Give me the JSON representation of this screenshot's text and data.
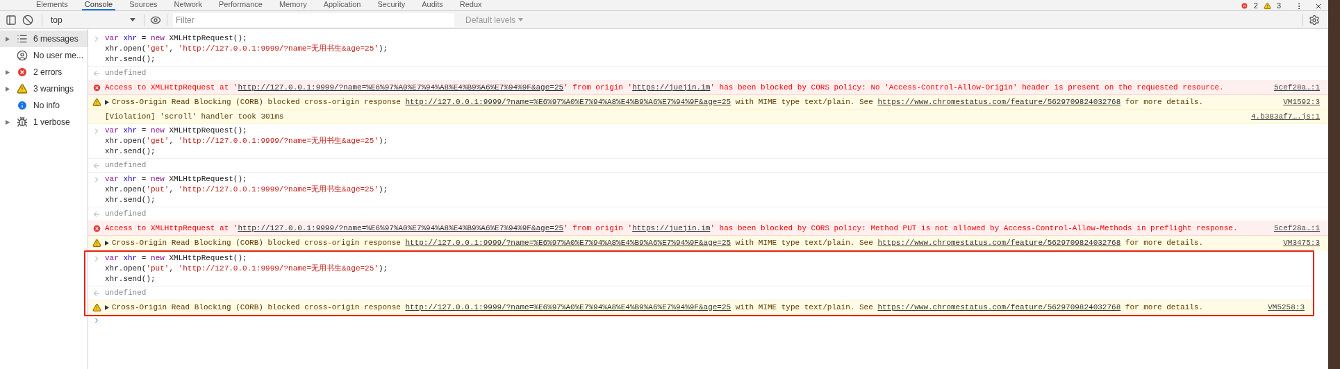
{
  "tabs": [
    {
      "label": "Elements",
      "selected": false
    },
    {
      "label": "Console",
      "selected": true
    },
    {
      "label": "Sources",
      "selected": false
    },
    {
      "label": "Network",
      "selected": false
    },
    {
      "label": "Performance",
      "selected": false
    },
    {
      "label": "Memory",
      "selected": false
    },
    {
      "label": "Application",
      "selected": false
    },
    {
      "label": "Security",
      "selected": false
    },
    {
      "label": "Audits",
      "selected": false
    },
    {
      "label": "Redux",
      "selected": false
    }
  ],
  "counts": {
    "errors": "2",
    "warnings": "3"
  },
  "toolbar": {
    "context": "top",
    "filter_placeholder": "Filter",
    "levels": "Default levels"
  },
  "sidebar": [
    {
      "kind": "list",
      "label": "6 messages",
      "selected": true,
      "expandable": true
    },
    {
      "kind": "user",
      "label": "No user me...",
      "selected": false,
      "expandable": false
    },
    {
      "kind": "error",
      "label": "2 errors",
      "selected": false,
      "expandable": true
    },
    {
      "kind": "warning",
      "label": "3 warnings",
      "selected": false,
      "expandable": true
    },
    {
      "kind": "info",
      "label": "No info",
      "selected": false,
      "expandable": false
    },
    {
      "kind": "verbose",
      "label": "1 verbose",
      "selected": false,
      "expandable": true
    }
  ],
  "entries": [
    {
      "kind": "input",
      "highlighted": false,
      "lines": [
        [
          {
            "kind": "keyword",
            "t": "var"
          },
          {
            "kind": "variable",
            "t": " xhr"
          },
          {
            "kind": "plain",
            "t": " = "
          },
          {
            "kind": "keyword",
            "t": "new"
          },
          {
            "kind": "plain",
            "t": " XMLHttpRequest();"
          }
        ],
        [
          {
            "kind": "plain",
            "t": "xhr.open("
          },
          {
            "kind": "string",
            "t": "'get'"
          },
          {
            "kind": "plain",
            "t": ", "
          },
          {
            "kind": "string",
            "t": "'http://127.0.0.1:9999/?name=无用书生&age=25'"
          },
          {
            "kind": "plain",
            "t": ");"
          }
        ],
        [
          {
            "kind": "plain",
            "t": "xhr.send();"
          }
        ]
      ]
    },
    {
      "kind": "result",
      "highlighted": false,
      "text": "undefined"
    },
    {
      "kind": "error",
      "highlighted": false,
      "expandable": false,
      "segments": [
        {
          "kind": "text",
          "t": "Access to XMLHttpRequest at '"
        },
        {
          "kind": "link",
          "t": "http://127.0.0.1:9999/?name=%E6%97%A0%E7%94%A8%E4%B9%A6%E7%94%9F&age=25"
        },
        {
          "kind": "text",
          "t": "' from origin '"
        },
        {
          "kind": "link",
          "t": "https://juejin.im"
        },
        {
          "kind": "text",
          "t": "' has been blocked by CORS policy: No 'Access-Control-Allow-Origin' header is present on the requested resource."
        }
      ],
      "source": "5cef28a…:1"
    },
    {
      "kind": "warning",
      "highlighted": false,
      "expandable": true,
      "segments": [
        {
          "kind": "text",
          "t": "Cross-Origin Read Blocking (CORB) blocked cross-origin response "
        },
        {
          "kind": "link",
          "t": "http://127.0.0.1:9999/?name=%E6%97%A0%E7%94%A8%E4%B9%A6%E7%94%9F&age=25"
        },
        {
          "kind": "text",
          "t": " with MIME type text/plain. See "
        },
        {
          "kind": "link",
          "t": "https://www.chromestatus.com/feature/5629709824032768"
        },
        {
          "kind": "text",
          "t": " for more details."
        }
      ],
      "source": "VM1592:3"
    },
    {
      "kind": "violation",
      "highlighted": false,
      "expandable": false,
      "segments": [
        {
          "kind": "text",
          "t": "[Violation] 'scroll' handler took 301ms"
        }
      ],
      "source": "4.b383af7….js:1"
    },
    {
      "kind": "input",
      "highlighted": false,
      "lines": [
        [
          {
            "kind": "keyword",
            "t": "var"
          },
          {
            "kind": "variable",
            "t": " xhr"
          },
          {
            "kind": "plain",
            "t": " = "
          },
          {
            "kind": "keyword",
            "t": "new"
          },
          {
            "kind": "plain",
            "t": " XMLHttpRequest();"
          }
        ],
        [
          {
            "kind": "plain",
            "t": "xhr.open("
          },
          {
            "kind": "string",
            "t": "'get'"
          },
          {
            "kind": "plain",
            "t": ", "
          },
          {
            "kind": "string",
            "t": "'http://127.0.0.1:9999/?name=无用书生&age=25'"
          },
          {
            "kind": "plain",
            "t": ");"
          }
        ],
        [
          {
            "kind": "plain",
            "t": "xhr.send();"
          }
        ]
      ]
    },
    {
      "kind": "result",
      "highlighted": false,
      "text": "undefined"
    },
    {
      "kind": "input",
      "highlighted": false,
      "lines": [
        [
          {
            "kind": "keyword",
            "t": "var"
          },
          {
            "kind": "variable",
            "t": " xhr"
          },
          {
            "kind": "plain",
            "t": " = "
          },
          {
            "kind": "keyword",
            "t": "new"
          },
          {
            "kind": "plain",
            "t": " XMLHttpRequest();"
          }
        ],
        [
          {
            "kind": "plain",
            "t": "xhr.open("
          },
          {
            "kind": "string",
            "t": "'put'"
          },
          {
            "kind": "plain",
            "t": ", "
          },
          {
            "kind": "string",
            "t": "'http://127.0.0.1:9999/?name=无用书生&age=25'"
          },
          {
            "kind": "plain",
            "t": ");"
          }
        ],
        [
          {
            "kind": "plain",
            "t": "xhr.send();"
          }
        ]
      ]
    },
    {
      "kind": "result",
      "highlighted": false,
      "text": "undefined"
    },
    {
      "kind": "error",
      "highlighted": false,
      "expandable": false,
      "segments": [
        {
          "kind": "text",
          "t": "Access to XMLHttpRequest at '"
        },
        {
          "kind": "link",
          "t": "http://127.0.0.1:9999/?name=%E6%97%A0%E7%94%A8%E4%B9%A6%E7%94%9F&age=25"
        },
        {
          "kind": "text",
          "t": "' from origin '"
        },
        {
          "kind": "link",
          "t": "https://juejin.im"
        },
        {
          "kind": "text",
          "t": "' has been blocked by CORS policy: Method PUT is not allowed by Access-Control-Allow-Methods in preflight response."
        }
      ],
      "source": "5cef28a…:1"
    },
    {
      "kind": "warning",
      "highlighted": false,
      "expandable": true,
      "segments": [
        {
          "kind": "text",
          "t": "Cross-Origin Read Blocking (CORB) blocked cross-origin response "
        },
        {
          "kind": "link",
          "t": "http://127.0.0.1:9999/?name=%E6%97%A0%E7%94%A8%E4%B9%A6%E7%94%9F&age=25"
        },
        {
          "kind": "text",
          "t": " with MIME type text/plain. See "
        },
        {
          "kind": "link",
          "t": "https://www.chromestatus.com/feature/5629709824032768"
        },
        {
          "kind": "text",
          "t": " for more details."
        }
      ],
      "source": "VM3475:3"
    },
    {
      "kind": "input",
      "highlighted": true,
      "lines": [
        [
          {
            "kind": "keyword",
            "t": "var"
          },
          {
            "kind": "variable",
            "t": " xhr"
          },
          {
            "kind": "plain",
            "t": " = "
          },
          {
            "kind": "keyword",
            "t": "new"
          },
          {
            "kind": "plain",
            "t": " XMLHttpRequest();"
          }
        ],
        [
          {
            "kind": "plain",
            "t": "xhr.open("
          },
          {
            "kind": "string",
            "t": "'put'"
          },
          {
            "kind": "plain",
            "t": ", "
          },
          {
            "kind": "string",
            "t": "'http://127.0.0.1:9999/?name=无用书生&age=25'"
          },
          {
            "kind": "plain",
            "t": ");"
          }
        ],
        [
          {
            "kind": "plain",
            "t": "xhr.send();"
          }
        ]
      ]
    },
    {
      "kind": "result",
      "highlighted": true,
      "text": "undefined"
    },
    {
      "kind": "warning",
      "highlighted": true,
      "expandable": true,
      "segments": [
        {
          "kind": "text",
          "t": "Cross-Origin Read Blocking (CORB) blocked cross-origin response "
        },
        {
          "kind": "link",
          "t": "http://127.0.0.1:9999/?name=%E6%97%A0%E7%94%A8%E4%B9%A6%E7%94%9F&age=25"
        },
        {
          "kind": "text",
          "t": " with MIME type text/plain. See "
        },
        {
          "kind": "link",
          "t": "https://www.chromestatus.com/feature/5629709824032768"
        },
        {
          "kind": "text",
          "t": " for more details."
        }
      ],
      "source": "VM5258:3"
    }
  ]
}
